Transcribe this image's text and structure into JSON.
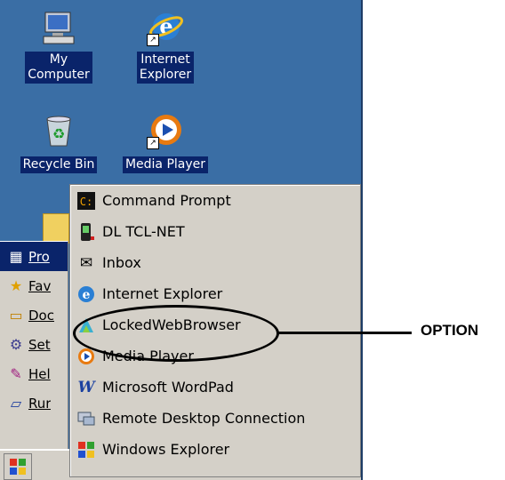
{
  "desktop": {
    "icons": [
      {
        "label_lines": [
          "My",
          "Computer"
        ],
        "icon": "my-computer-icon"
      },
      {
        "label_lines": [
          "Internet",
          "Explorer"
        ],
        "icon": "internet-explorer-icon"
      },
      {
        "label_lines": [
          "Recycle Bin"
        ],
        "icon": "recycle-bin-icon"
      },
      {
        "label_lines": [
          "Media Player"
        ],
        "icon": "media-player-icon"
      }
    ]
  },
  "start_menu": {
    "items": [
      {
        "label": "Programs",
        "visible_text": "Pro",
        "icon": "programs-folder-icon"
      },
      {
        "label": "Favorites",
        "visible_text": "Fav",
        "icon": "favorites-star-icon"
      },
      {
        "label": "Documents",
        "visible_text": "Doc",
        "icon": "documents-icon"
      },
      {
        "label": "Settings",
        "visible_text": "Set",
        "icon": "settings-icon"
      },
      {
        "label": "Help",
        "visible_text": "Hel",
        "icon": "help-book-icon"
      },
      {
        "label": "Run",
        "visible_text": "Rur",
        "icon": "run-icon"
      }
    ]
  },
  "programs_menu": {
    "items": [
      {
        "label": "Command Prompt",
        "icon": "command-prompt-icon"
      },
      {
        "label": "DL TCL-NET",
        "icon": "device-icon"
      },
      {
        "label": "Inbox",
        "icon": "inbox-icon"
      },
      {
        "label": "Internet Explorer",
        "icon": "internet-explorer-icon"
      },
      {
        "label": "LockedWebBrowser",
        "icon": "browser-icon"
      },
      {
        "label": "Media Player",
        "icon": "media-player-icon"
      },
      {
        "label": "Microsoft WordPad",
        "icon": "wordpad-icon"
      },
      {
        "label": "Remote Desktop Connection",
        "icon": "remote-desktop-icon"
      },
      {
        "label": "Windows Explorer",
        "icon": "windows-explorer-icon"
      }
    ]
  },
  "annotation": {
    "label": "OPTION"
  },
  "colors": {
    "desktop_background": "#3a6ea5",
    "selection_highlight": "#0a246a",
    "menu_background": "#d4d0c8"
  }
}
